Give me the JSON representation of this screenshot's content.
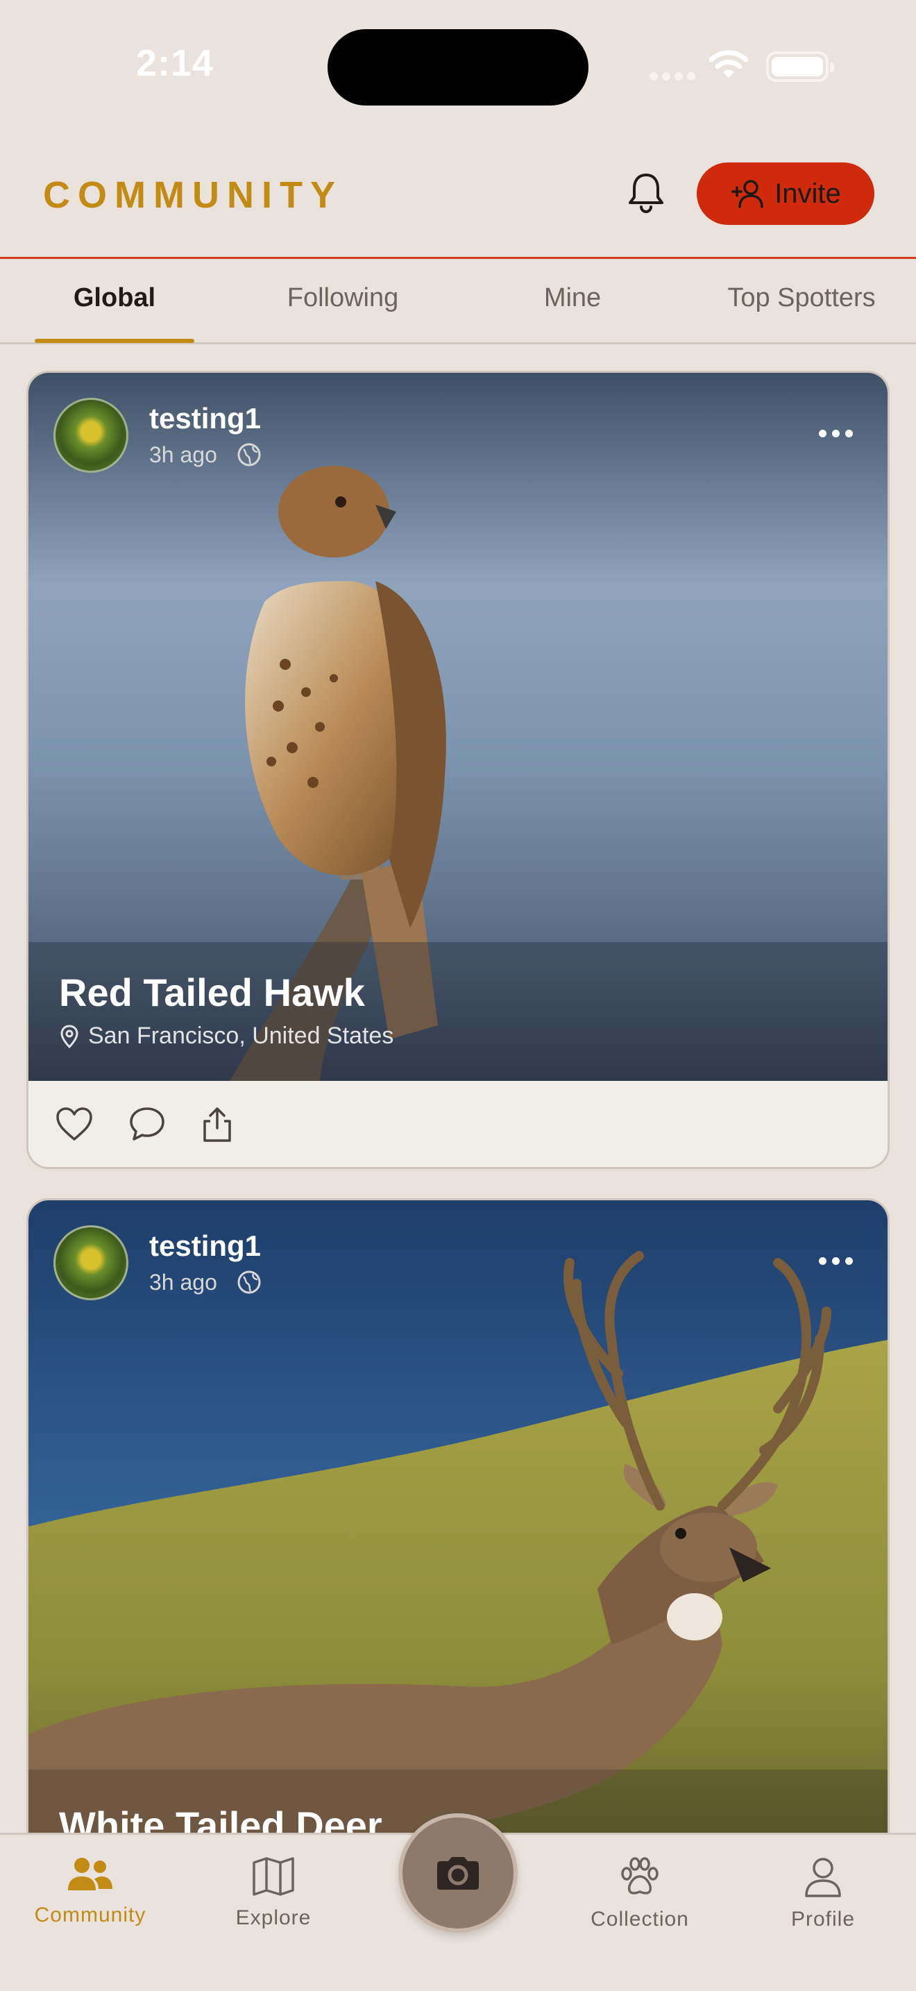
{
  "status_bar": {
    "time": "2:14"
  },
  "header": {
    "title": "COMMUNITY",
    "invite_label": "Invite"
  },
  "tabs": [
    {
      "label": "Global",
      "active": true
    },
    {
      "label": "Following",
      "active": false
    },
    {
      "label": "Mine",
      "active": false
    },
    {
      "label": "Top Spotters",
      "active": false
    }
  ],
  "posts": [
    {
      "username": "testing1",
      "time": "3h ago",
      "visibility_icon": "globe-icon",
      "species": "Red Tailed Hawk",
      "location": "San Francisco, United States"
    },
    {
      "username": "testing1",
      "time": "3h ago",
      "visibility_icon": "globe-icon",
      "species": "White Tailed Deer"
    }
  ],
  "tabbar": {
    "items": [
      {
        "label": "Community",
        "icon": "people-icon",
        "active": true
      },
      {
        "label": "Explore",
        "icon": "map-icon",
        "active": false
      },
      {
        "label": "Collection",
        "icon": "paw-icon",
        "active": false
      },
      {
        "label": "Profile",
        "icon": "person-icon",
        "active": false
      }
    ],
    "center_icon": "camera-icon"
  },
  "colors": {
    "accent": "#C28B13",
    "invite": "#D02A0C",
    "background": "#EAE2DC"
  }
}
